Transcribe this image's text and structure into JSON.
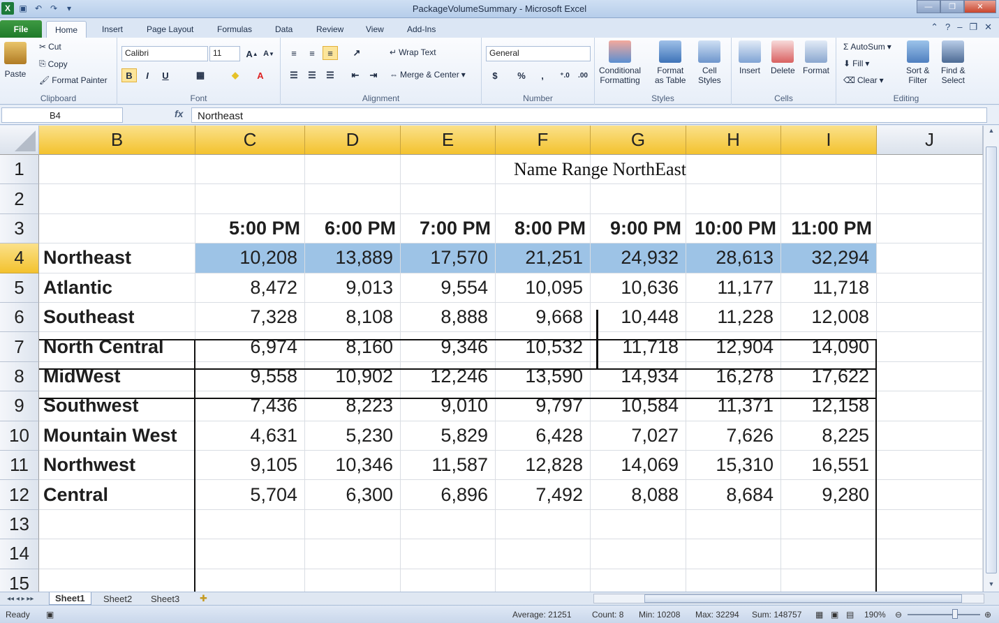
{
  "window": {
    "title": "PackageVolumeSummary  -  Microsoft Excel",
    "app_icon": "X"
  },
  "ribbon_tabs": [
    "File",
    "Home",
    "Insert",
    "Page Layout",
    "Formulas",
    "Data",
    "Review",
    "View",
    "Add-Ins"
  ],
  "active_tab": "Home",
  "clipboard": {
    "paste": "Paste",
    "cut": "Cut",
    "copy": "Copy",
    "format_painter": "Format Painter",
    "label": "Clipboard"
  },
  "font": {
    "name": "Calibri",
    "size": "11",
    "bold": "B",
    "italic": "I",
    "underline": "U",
    "label": "Font"
  },
  "alignment": {
    "wrap": "Wrap Text",
    "merge": "Merge & Center",
    "label": "Alignment"
  },
  "number": {
    "format": "General",
    "currency": "$",
    "percent": "%",
    "comma": ",",
    "label": "Number"
  },
  "styles": {
    "conditional": "Conditional",
    "conditional2": "Formatting",
    "format_as": "Format",
    "format_as2": "as Table",
    "cell": "Cell",
    "cell2": "Styles",
    "label": "Styles"
  },
  "cells": {
    "insert": "Insert",
    "delete": "Delete",
    "format": "Format",
    "label": "Cells"
  },
  "editing": {
    "autosum": "AutoSum",
    "fill": "Fill",
    "clear": "Clear",
    "sort": "Sort &",
    "sort2": "Filter",
    "find": "Find &",
    "find2": "Select",
    "label": "Editing"
  },
  "formula_bar": {
    "name_box": "B4",
    "fx": "fx",
    "content": "Northeast"
  },
  "columns": [
    "B",
    "C",
    "D",
    "E",
    "F",
    "G",
    "H",
    "I",
    "J"
  ],
  "rows": [
    "1",
    "2",
    "3",
    "4",
    "5",
    "6",
    "7",
    "8",
    "9",
    "10",
    "11",
    "12",
    "13",
    "14",
    "15"
  ],
  "sheet_title": "Name Range NorthEast",
  "time_headers": [
    "5:00 PM",
    "6:00 PM",
    "7:00 PM",
    "8:00 PM",
    "9:00 PM",
    "10:00 PM",
    "11:00 PM"
  ],
  "regions": [
    {
      "name": "Northeast",
      "values": [
        "10,208",
        "13,889",
        "17,570",
        "21,251",
        "24,932",
        "28,613",
        "32,294"
      ]
    },
    {
      "name": "Atlantic",
      "values": [
        "8,472",
        "9,013",
        "9,554",
        "10,095",
        "10,636",
        "11,177",
        "11,718"
      ]
    },
    {
      "name": "Southeast",
      "values": [
        "7,328",
        "8,108",
        "8,888",
        "9,668",
        "10,448",
        "11,228",
        "12,008"
      ]
    },
    {
      "name": "North Central",
      "values": [
        "6,974",
        "8,160",
        "9,346",
        "10,532",
        "11,718",
        "12,904",
        "14,090"
      ]
    },
    {
      "name": "MidWest",
      "values": [
        "9,558",
        "10,902",
        "12,246",
        "13,590",
        "14,934",
        "16,278",
        "17,622"
      ]
    },
    {
      "name": "Southwest",
      "values": [
        "7,436",
        "8,223",
        "9,010",
        "9,797",
        "10,584",
        "11,371",
        "12,158"
      ]
    },
    {
      "name": "Mountain West",
      "values": [
        "4,631",
        "5,230",
        "5,829",
        "6,428",
        "7,027",
        "7,626",
        "8,225"
      ]
    },
    {
      "name": "Northwest",
      "values": [
        "9,105",
        "10,346",
        "11,587",
        "12,828",
        "14,069",
        "15,310",
        "16,551"
      ]
    },
    {
      "name": "Central",
      "values": [
        "5,704",
        "6,300",
        "6,896",
        "7,492",
        "8,088",
        "8,684",
        "9,280"
      ]
    }
  ],
  "sheet_tabs": [
    "Sheet1",
    "Sheet2",
    "Sheet3"
  ],
  "status": {
    "ready": "Ready",
    "average": "Average: 21251",
    "count": "Count: 8",
    "min": "Min: 10208",
    "max": "Max: 32294",
    "sum": "Sum: 148757",
    "zoom": "190%"
  },
  "colors": {
    "selected_range": "#9dc3e6",
    "header_selected": "#f3c22e",
    "file_tab": "#1f7a2a"
  }
}
